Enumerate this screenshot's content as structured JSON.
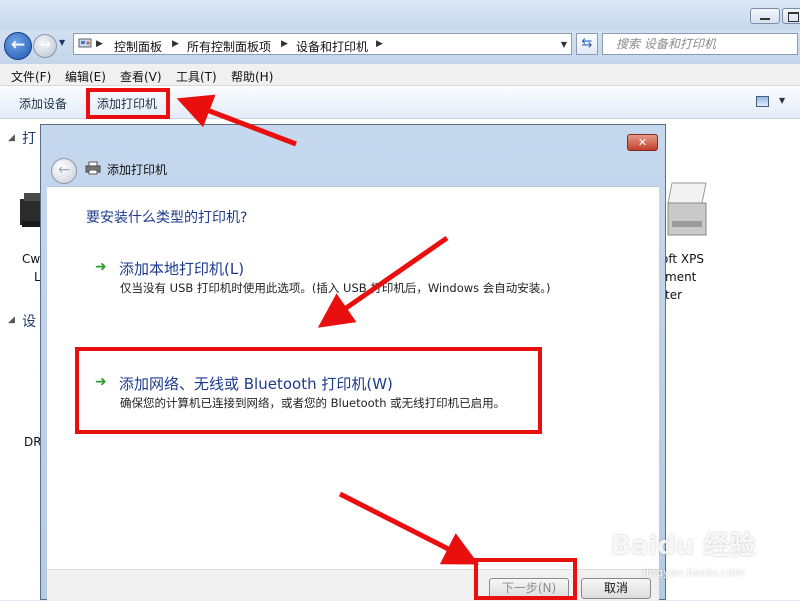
{
  "explorer": {
    "breadcrumbs": [
      "控制面板",
      "所有控制面板项",
      "设备和打印机"
    ],
    "search_placeholder": "搜索 设备和打印机",
    "menu": [
      "文件(F)",
      "编辑(E)",
      "查看(V)",
      "工具(T)",
      "帮助(H)"
    ],
    "commands": {
      "add_device": "添加设备",
      "add_printer": "添加打印机"
    },
    "groups": {
      "printers": "打",
      "devices": "设"
    },
    "bg_labels": {
      "left_printer_1": "Cw",
      "left_printer_2": "L",
      "right_printer_1": "oft XPS",
      "right_printer_2": "ment",
      "right_printer_3": "ter",
      "left_device": "DR"
    }
  },
  "dialog": {
    "title": "添加打印机",
    "question": "要安装什么类型的打印机?",
    "options": [
      {
        "title": "添加本地打印机(L)",
        "description": "仅当没有 USB 打印机时使用此选项。(插入 USB 打印机后，Windows 会自动安装。)"
      },
      {
        "title": "添加网络、无线或 Bluetooth 打印机(W)",
        "description": "确保您的计算机已连接到网络，或者您的 Bluetooth 或无线打印机已启用。"
      }
    ],
    "buttons": {
      "next": "下一步(N)",
      "cancel": "取消"
    }
  },
  "watermark": {
    "brand": "Baidu 经验",
    "url": "jingyan.baidu.com"
  },
  "colors": {
    "annotation_red": "#ea0f0f",
    "link_blue": "#1e3b8f",
    "arrow_green": "#2d9a2d"
  },
  "icons": [
    "back-arrow-icon",
    "forward-arrow-icon",
    "control-panel-icon",
    "refresh-icon",
    "view-options-icon",
    "printer-icon",
    "close-icon",
    "green-arrow-icon"
  ]
}
